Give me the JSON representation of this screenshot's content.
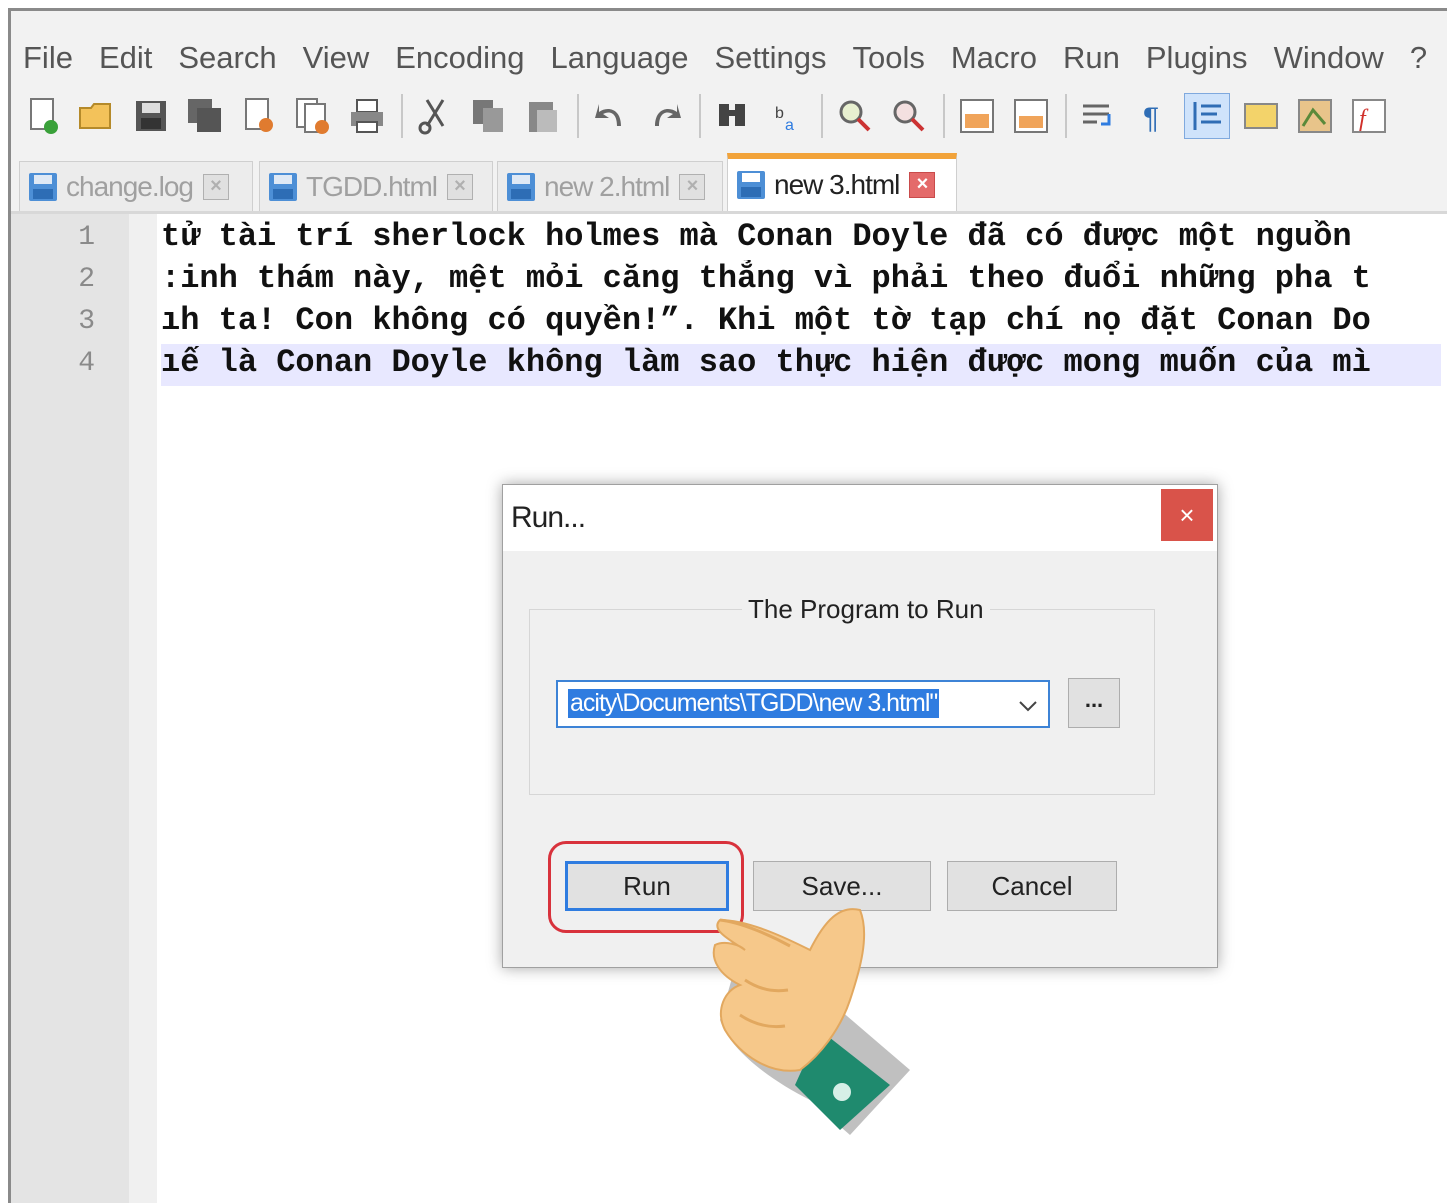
{
  "menu": [
    "File",
    "Edit",
    "Search",
    "View",
    "Encoding",
    "Language",
    "Settings",
    "Tools",
    "Macro",
    "Run",
    "Plugins",
    "Window",
    "?"
  ],
  "toolbar": [
    "new-file-icon",
    "open-file-icon",
    "save-icon",
    "save-all-icon",
    "close-icon",
    "close-all-icon",
    "print-icon",
    "|",
    "cut-icon",
    "copy-icon",
    "paste-icon",
    "|",
    "undo-icon",
    "redo-icon",
    "|",
    "find-icon",
    "replace-icon",
    "|",
    "zoom-in-icon",
    "zoom-out-icon",
    "|",
    "sync-vertical-icon",
    "sync-horizontal-icon",
    "|",
    "word-wrap-icon",
    "show-all-chars-icon",
    "indent-guide-icon",
    "user-defined-lang-icon",
    "doc-map-icon",
    "function-list-icon"
  ],
  "tabs": [
    {
      "label": "change.log",
      "active": false
    },
    {
      "label": "TGDD.html",
      "active": false
    },
    {
      "label": "new 2.html",
      "active": false
    },
    {
      "label": "new 3.html",
      "active": true
    }
  ],
  "editor": {
    "lines": [
      {
        "num": "1",
        "text": "tử tài trí sherlock holmes mà Conan Doyle đã có được một nguồn"
      },
      {
        "num": "2",
        "text": ":inh thám này, mệt mỏi căng thẳng vì phải theo đuổi những pha t"
      },
      {
        "num": "3",
        "text": "ıh ta! Con không có quyền!”. Khi một tờ tạp chí nọ đặt Conan Do"
      },
      {
        "num": "4",
        "text": "ıế là Conan Doyle không làm sao thực hiện được mong muốn của mì"
      }
    ]
  },
  "dialog": {
    "title": "Run...",
    "close": "×",
    "group_label": "The Program to Run",
    "program_value": "acity\\Documents\\TGDD\\new 3.html\"",
    "browse_label": "...",
    "run_label": "Run",
    "save_label": "Save...",
    "cancel_label": "Cancel"
  },
  "colors": {
    "accent": "#2f7ce0",
    "close_red": "#d9534a",
    "highlight_ring": "#d8323c",
    "tab_active_top": "#f2a33a"
  }
}
